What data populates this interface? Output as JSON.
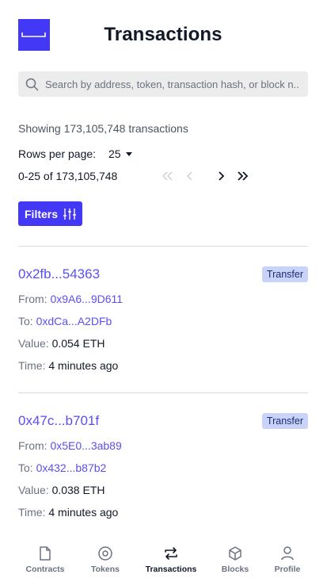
{
  "header": {
    "title": "Transactions",
    "logo_icon": "box-logo-icon"
  },
  "search": {
    "placeholder": "Search by address, token, transaction hash, or block n..."
  },
  "summary": {
    "showing_text": "Showing 173,105,748 transactions"
  },
  "pagination": {
    "rows_label": "Rows per page:",
    "rows_value": "25",
    "range_text": "0-25 of 173,105,748"
  },
  "filters": {
    "label": "Filters"
  },
  "transactions": [
    {
      "hash": "0x2fb...54363",
      "type": "Transfer",
      "from_label": "From:",
      "from": "0x9A6...9D611",
      "to_label": "To:",
      "to": "0xdCa...A2DFb",
      "value_label": "Value:",
      "value": "0.054 ETH",
      "time_label": "Time:",
      "time": "4 minutes ago"
    },
    {
      "hash": "0x47c...b701f",
      "type": "Transfer",
      "from_label": "From:",
      "from": "0x5E0...3ab89",
      "to_label": "To:",
      "to": "0x432...b87b2",
      "value_label": "Value:",
      "value": "0.038 ETH",
      "time_label": "Time:",
      "time": "4 minutes ago"
    }
  ],
  "nav": {
    "items": [
      {
        "label": "Contracts",
        "icon": "document-icon"
      },
      {
        "label": "Tokens",
        "icon": "token-icon"
      },
      {
        "label": "Transactions",
        "icon": "swap-arrows-icon",
        "active": true
      },
      {
        "label": "Blocks",
        "icon": "cube-icon"
      },
      {
        "label": "Profile",
        "icon": "user-icon"
      }
    ]
  },
  "colors": {
    "accent": "#4338f5",
    "link": "#5b4ff0",
    "badge_bg": "#c9d3f8"
  }
}
